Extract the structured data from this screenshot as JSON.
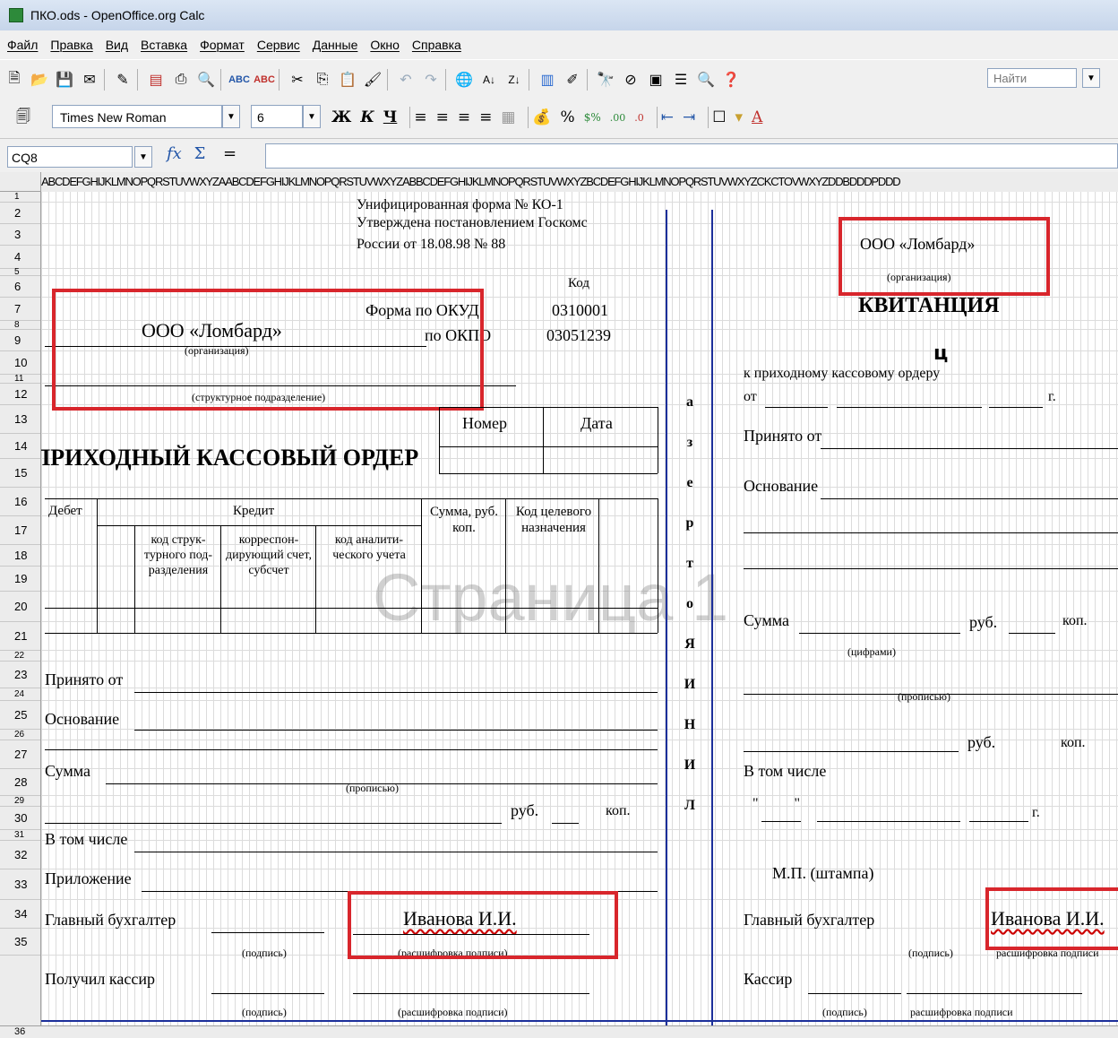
{
  "window": {
    "title": "ПКО.ods - OpenOffice.org Calc"
  },
  "menu": [
    "Файл",
    "Правка",
    "Вид",
    "Вставка",
    "Формат",
    "Сервис",
    "Данные",
    "Окно",
    "Справка"
  ],
  "toolbar": {
    "find_placeholder": "Найти"
  },
  "format_bar": {
    "font_name": "Times New Roman",
    "font_size": "6",
    "bold": "Ж",
    "italic": "К",
    "underline": "Ч"
  },
  "formula_bar": {
    "cell_ref": "CQ8",
    "fx": "fx",
    "sum": "Σ",
    "equals": "="
  },
  "column_header": "ABCDEFGHIJKLMNOPQRSTUVWXYZAABCDEFGHIJKLMNOPQRSTUVWXYZABBCDEFGHIJKLMNOPQRSTUVWXYZBCDEFGHIJKLMNOPQRSTUVWXYZCKCTOVWXYZDDBDDDPDDD",
  "row_numbers": [
    "1",
    "2",
    "3",
    "4",
    "5",
    "6",
    "7",
    "8",
    "9",
    "10",
    "11",
    "12",
    "13",
    "14",
    "15",
    "16",
    "17",
    "18",
    "19",
    "20",
    "21",
    "22",
    "23",
    "24",
    "25",
    "26",
    "27",
    "28",
    "29",
    "30",
    "31",
    "32",
    "33",
    "34",
    "35",
    "36"
  ],
  "form": {
    "header_line1": "Унифицированная форма № КО-1",
    "header_line2": "Утверждена постановлением Госкомс",
    "header_line3": "России от 18.08.98 № 88",
    "kod": "Код",
    "okud_label": "Форма по ОКУД",
    "okud_value": "0310001",
    "okpo_label": "по ОКПО",
    "okpo_value": "03051239",
    "org_name": "ООО «Ломбард»",
    "org_caption": "(организация)",
    "subdivision_caption": "(структурное подразделение)",
    "number_hdr": "Номер",
    "date_hdr": "Дата",
    "title": "ПРИХОДНЫЙ КАССОВЫЙ ОРДЕР",
    "table": {
      "debit": "Дебет",
      "credit": "Кредит",
      "sum": "Сумма, руб. коп.",
      "purpose": "Код целевого назначения",
      "struct": "код струк- турного под- разделения",
      "corr": "корреспон- дирующий счет, субсчет",
      "analytic": "код аналити- ческого учета"
    },
    "accepted_from": "Принято от",
    "basis": "Основание",
    "sum_label": "Сумма",
    "in_words": "(прописью)",
    "rub": "руб.",
    "kop": "коп.",
    "including": "В том числе",
    "attachment": "Приложение",
    "chief_accountant": "Главный бухгалтер",
    "chief_name": "Иванова И.И.",
    "signature": "(подпись)",
    "signature_decode": "(расшифровка подписи)",
    "cashier": "Получил кассир"
  },
  "cut_line": [
    "Л",
    "И",
    "Н",
    "И",
    "Я",
    "о",
    "т",
    "р",
    "е",
    "з",
    "а"
  ],
  "receipt": {
    "org_name": "ООО «Ломбард»",
    "org_caption": "(организация)",
    "title": "КВИТАНЦИЯ",
    "to_order": "к приходному кассовому ордеру",
    "from": "от",
    "year": "г.",
    "accepted": "Принято от",
    "basis": "Основание",
    "sum": "Сумма",
    "rub": "руб.",
    "kop": "коп.",
    "digits": "(цифрами)",
    "in_words": "(прописью)",
    "including": "В том числе",
    "stamp": "М.П. (штампа)",
    "chief_accountant": "Главный бухгалтер",
    "chief_name": "Иванова И.И.",
    "signature": "(подпись)",
    "signature_decode": "расшифровка подписи",
    "cashier": "Кассир"
  },
  "watermark": "Страница 1",
  "colors": {
    "red_frame": "#d8262c",
    "page_break": "#1c2f9a"
  }
}
